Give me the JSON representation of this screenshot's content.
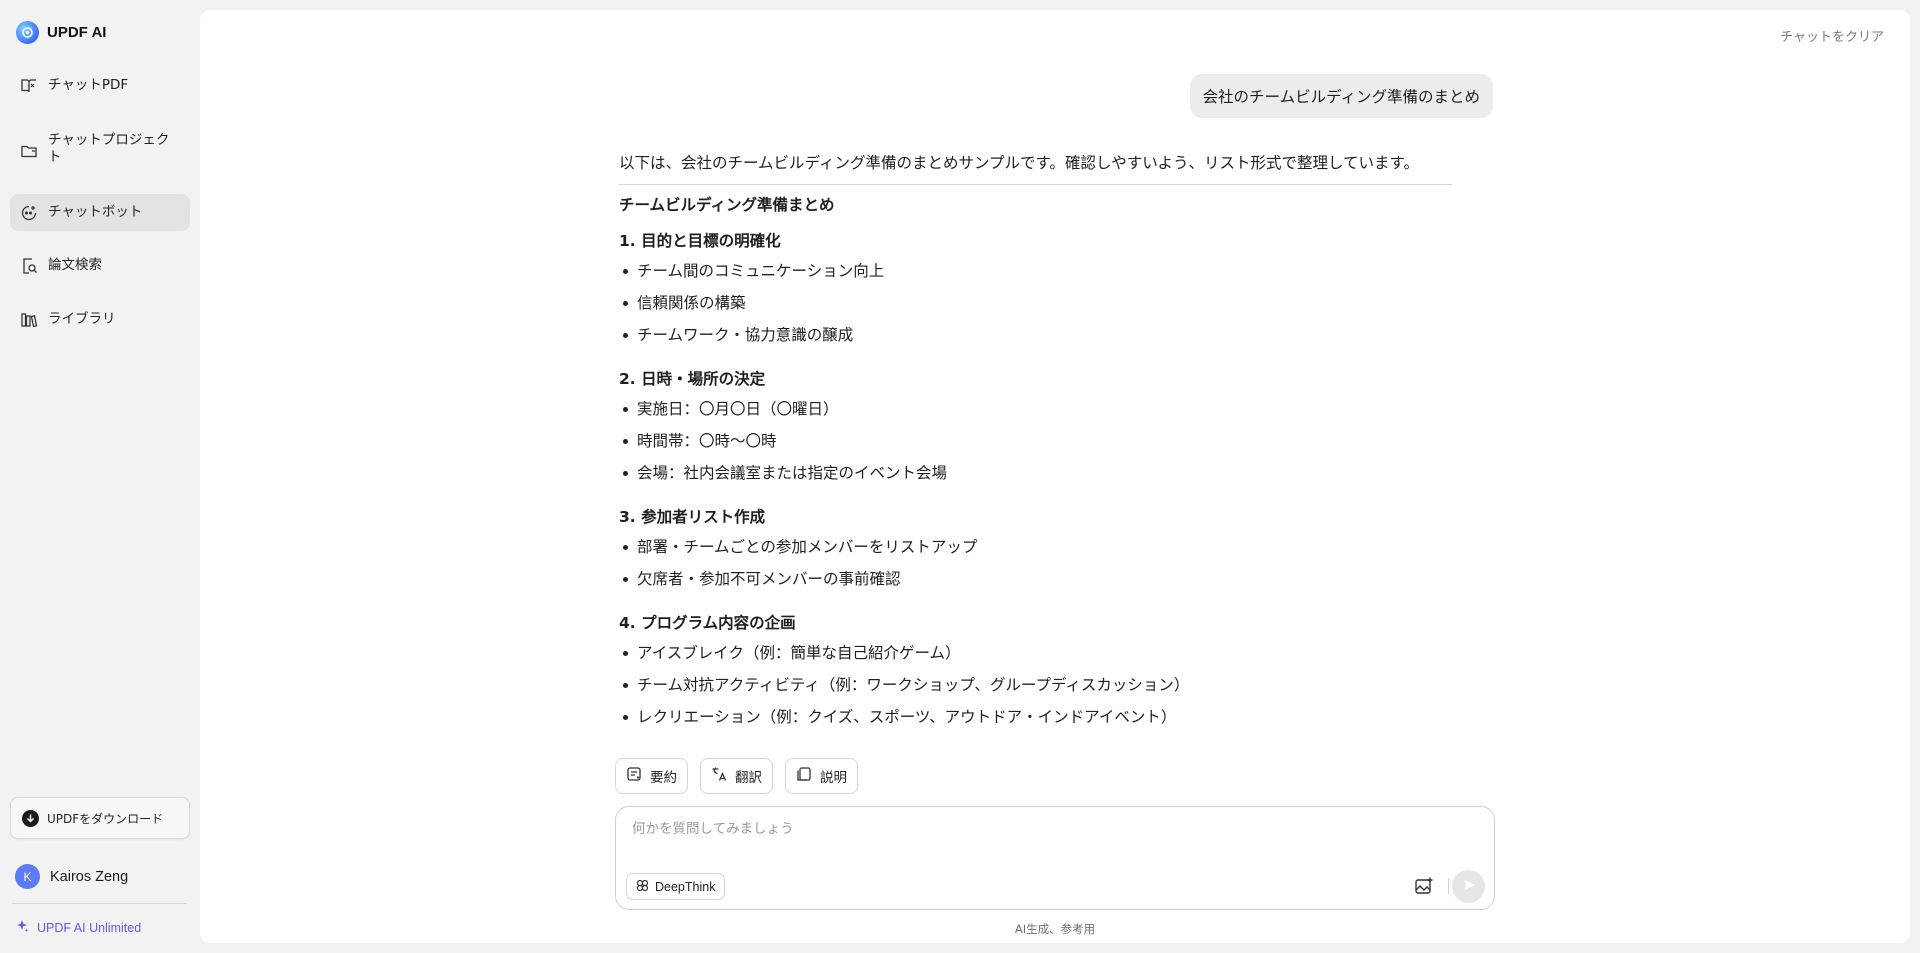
{
  "brand": {
    "name": "UPDF AI"
  },
  "sidebar": {
    "items": [
      {
        "label": "チャットPDF",
        "icon": "book-icon"
      },
      {
        "label": "チャットプロジェクト",
        "icon": "folder-icon"
      },
      {
        "label": "チャットボット",
        "icon": "chatbot-icon",
        "active": true
      },
      {
        "label": "論文検索",
        "icon": "paper-search-icon"
      },
      {
        "label": "ライブラリ",
        "icon": "library-icon"
      }
    ],
    "download_label": "UPDFをダウンロード",
    "user": {
      "initial": "K",
      "name": "Kairos Zeng"
    },
    "plan_label": "UPDF AI Unlimited"
  },
  "header": {
    "clear_label": "チャットをクリア"
  },
  "chat": {
    "user_message": "会社のチームビルディング準備のまとめ",
    "answer": {
      "intro": "以下は、会社のチームビルディング準備のまとめサンプルです。確認しやすいよう、リスト形式で整理しています。",
      "title": "チームビルディング準備まとめ",
      "sections": [
        {
          "heading": "1. 目的と目標の明確化",
          "items": [
            "チーム間のコミュニケーション向上",
            "信頼関係の構築",
            "チームワーク・協力意識の醸成"
          ]
        },
        {
          "heading": "2. 日時・場所の決定",
          "items": [
            "実施日：〇月〇日（〇曜日）",
            "時間帯：〇時～〇時",
            "会場：社内会議室または指定のイベント会場"
          ]
        },
        {
          "heading": "3. 参加者リスト作成",
          "items": [
            "部署・チームごとの参加メンバーをリストアップ",
            "欠席者・参加不可メンバーの事前確認"
          ]
        },
        {
          "heading": "4. プログラム内容の企画",
          "items": [
            "アイスブレイク（例：簡単な自己紹介ゲーム）",
            "チーム対抗アクティビティ（例：ワークショップ、グループディスカッション）",
            "レクリエーション（例：クイズ、スポーツ、アウトドア・インドアイベント）"
          ]
        }
      ]
    },
    "actions": [
      {
        "label": "要約",
        "icon": "summary-icon"
      },
      {
        "label": "翻訳",
        "icon": "translate-icon"
      },
      {
        "label": "説明",
        "icon": "explain-icon"
      }
    ]
  },
  "composer": {
    "placeholder": "何かを質問してみましょう",
    "value": "",
    "deepthink_label": "DeepThink"
  },
  "footer": {
    "note": "AI生成、参考用"
  },
  "colors": {
    "accent": "#6b57e8",
    "active_bg": "#e3e3e6",
    "avatar": "#5b7cf6"
  }
}
